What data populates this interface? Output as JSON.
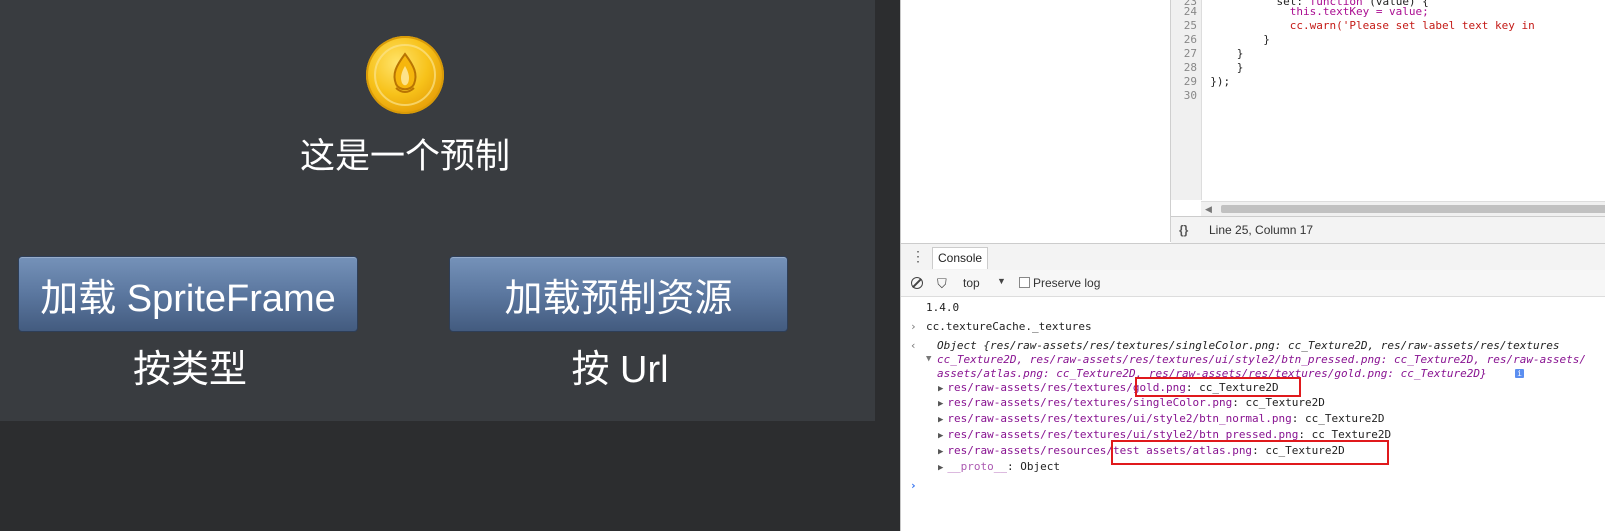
{
  "game": {
    "prefab_title": "这是一个预制",
    "btn_sprite_label": "加载 SpriteFrame",
    "btn_prefab_label": "加载预制资源",
    "caption_type": "按类型",
    "caption_url": "按 Url"
  },
  "editor": {
    "lines": [
      {
        "num": "24",
        "text": "            this.textKey = value;"
      },
      {
        "num": "25",
        "text": "            cc.warn('Please set label text key in"
      },
      {
        "num": "26",
        "text": "        }"
      },
      {
        "num": "27",
        "text": "    }"
      },
      {
        "num": "28",
        "text": "    }"
      },
      {
        "num": "29",
        "text": "});"
      },
      {
        "num": "30",
        "text": ""
      }
    ],
    "status_braces": "{}",
    "status_position": "Line 25, Column 17"
  },
  "console": {
    "tab_label": "Console",
    "context": "top",
    "preserve_log": "Preserve log",
    "version": "1.4.0",
    "command": "cc.textureCache._textures",
    "object_line1": "Object {res/raw-assets/res/textures/singleColor.png: cc_Texture2D, res/raw-assets/res/textures",
    "object_line2": "cc_Texture2D, res/raw-assets/res/textures/ui/style2/btn_pressed.png: cc_Texture2D, res/raw-assets/",
    "object_line3": "assets/atlas.png: cc_Texture2D, res/raw-assets/res/textures/gold.png: cc_Texture2D}",
    "entries": [
      {
        "key": "res/raw-assets/res/textures/gold.png",
        "type": "cc_Texture2D"
      },
      {
        "key": "res/raw-assets/res/textures/singleColor.png",
        "type": "cc_Texture2D"
      },
      {
        "key": "res/raw-assets/res/textures/ui/style2/btn_normal.png",
        "type": "cc_Texture2D"
      },
      {
        "key": "res/raw-assets/res/textures/ui/style2/btn_pressed.png",
        "type": "cc_Texture2D"
      },
      {
        "key": "res/raw-assets/resources/test assets/atlas.png",
        "type": "cc_Texture2D"
      }
    ],
    "proto_key": "__proto__",
    "proto_val": "Object"
  },
  "colors": {
    "button_blue": "#5b779f",
    "highlight_red": "#e0191c",
    "canvas_bg": "#393c40"
  }
}
